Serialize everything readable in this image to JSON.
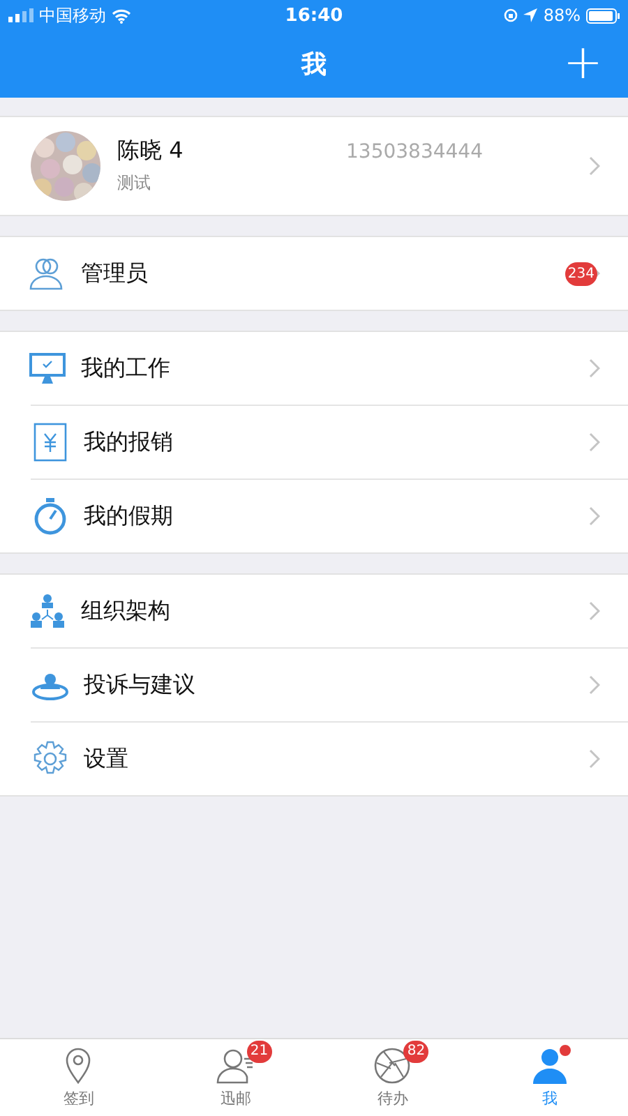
{
  "status_bar": {
    "carrier": "中国移动",
    "time": "16:40",
    "battery": "88%"
  },
  "nav": {
    "title": "我",
    "action": "+"
  },
  "profile": {
    "name": "陈晓 4",
    "subtitle": "测试",
    "phone": "13503834444"
  },
  "groups": [
    [
      {
        "kind": "admin",
        "label": "管理员",
        "badge": "234"
      }
    ],
    [
      {
        "kind": "work",
        "label": "我的工作"
      },
      {
        "kind": "expense",
        "label": "我的报销"
      },
      {
        "kind": "leave",
        "label": "我的假期"
      }
    ],
    [
      {
        "kind": "org",
        "label": "组织架构"
      },
      {
        "kind": "feedback",
        "label": "投诉与建议"
      },
      {
        "kind": "settings",
        "label": "设置"
      }
    ]
  ],
  "tabs": [
    {
      "kind": "checkin",
      "label": "签到",
      "selected": false
    },
    {
      "kind": "mail",
      "label": "迅邮",
      "selected": false,
      "badge": "21"
    },
    {
      "kind": "todo",
      "label": "待办",
      "selected": false,
      "badge": "82"
    },
    {
      "kind": "me",
      "label": "我",
      "selected": true,
      "dot": true
    }
  ]
}
